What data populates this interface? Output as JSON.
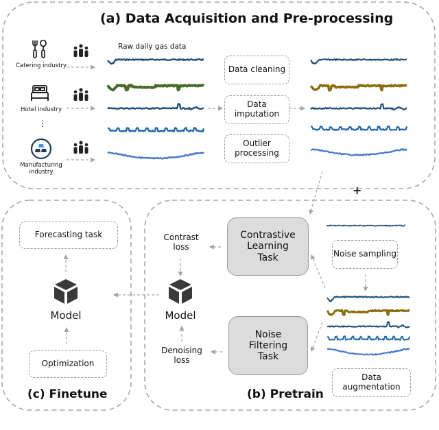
{
  "panels": {
    "acquisition": {
      "title": "(a) Data Acquisition and Pre-processing",
      "raw_label": "Raw daily gas data",
      "industries": [
        {
          "label": "Catering industry",
          "icon": "fork-spoon-icon"
        },
        {
          "label": "Hotel industry",
          "icon": "bed-icon"
        },
        {
          "label": "⋮",
          "icon": "ellipsis-vertical-icon"
        },
        {
          "label": "Manufacturing industry",
          "icon": "factory-circle-icon"
        }
      ],
      "steps": [
        "Data cleaning",
        "Data imputation",
        "Outlier processing"
      ],
      "raw_series_colors": [
        "#1f4e79",
        "#4a6b2a",
        "#1f4e79",
        "#2166ac",
        "#4477cc"
      ],
      "processed_series_colors": [
        "#1f4e79",
        "#8a6d0b",
        "#1f4e79",
        "#2166ac",
        "#4477cc"
      ]
    },
    "pretrain": {
      "title": "(b) Pretrain",
      "contrastive_task": "Contrastive Learning Task",
      "noise_task": "Noise Filtering Task",
      "contrast_loss": "Contrast loss",
      "denoising_loss": "Denoising loss",
      "model_label": "Model",
      "noise_sampling": "Noise sampling",
      "data_augmentation": "Data augmentation",
      "plus": "+",
      "noise_color": "#1f4e79"
    },
    "finetune": {
      "title": "(c) Finetune",
      "forecasting": "Forecasting task",
      "model_label": "Model",
      "optimization": "Optimization"
    }
  },
  "colors": {
    "dash": "#a6a6a6",
    "task_fill": "#dcdcdc",
    "model_icon": "#3a3a3a",
    "people_icon": "#222222",
    "manufacturing_ring": "#1f3a5a",
    "manufacturing_top": "#4a90d9"
  }
}
